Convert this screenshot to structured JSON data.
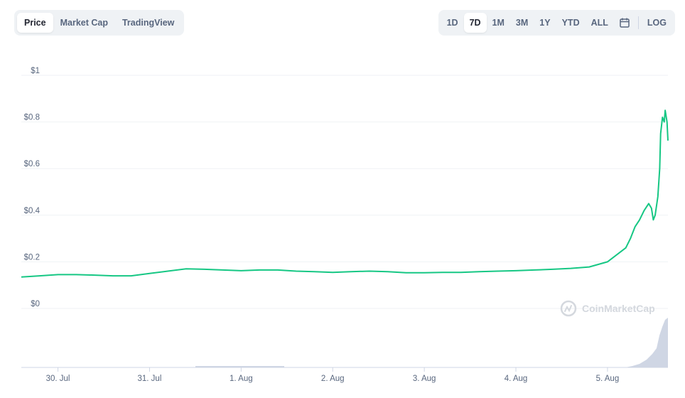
{
  "chart_tabs": [
    "Price",
    "Market Cap",
    "TradingView"
  ],
  "active_chart_tab": "Price",
  "ranges": [
    "1D",
    "7D",
    "1M",
    "3M",
    "1Y",
    "YTD",
    "ALL"
  ],
  "active_range": "7D",
  "log_label": "LOG",
  "icons": {
    "calendar": "calendar-icon",
    "watermark": "coinmarketcap-logo-icon"
  },
  "watermark": "CoinMarketCap",
  "colors": {
    "line": "#16c784",
    "volume": "#cfd6e4",
    "grid": "#eff2f5",
    "text": "#58667e"
  },
  "chart_data": {
    "type": "line",
    "y_tick_labels": [
      "$0",
      "$0.2",
      "$0.4",
      "$0.6",
      "$0.8",
      "$1"
    ],
    "ylim": [
      0,
      1
    ],
    "x_tick_labels": [
      "30. Jul",
      "31. Jul",
      "1. Aug",
      "2. Aug",
      "3. Aug",
      "4. Aug",
      "5. Aug"
    ],
    "x_tick_days": [
      0,
      1,
      2,
      3,
      4,
      5,
      6
    ],
    "xlim": [
      -0.4,
      6.66
    ],
    "grid": true,
    "legend": "none",
    "series": [
      {
        "x": [
          -0.4,
          -0.2,
          0.0,
          0.2,
          0.4,
          0.6,
          0.8,
          1.0,
          1.2,
          1.4,
          1.6,
          1.8,
          2.0,
          2.2,
          2.4,
          2.6,
          2.8,
          3.0,
          3.2,
          3.4,
          3.6,
          3.8,
          4.0,
          4.2,
          4.4,
          4.6,
          4.8,
          5.0,
          5.2,
          5.4,
          5.6,
          5.8,
          6.0,
          6.1,
          6.2,
          6.25,
          6.3,
          6.35,
          6.4,
          6.45,
          6.48,
          6.5,
          6.52,
          6.55,
          6.57,
          6.58,
          6.6,
          6.62,
          6.63,
          6.65,
          6.66
        ],
        "y": [
          0.135,
          0.14,
          0.145,
          0.145,
          0.143,
          0.14,
          0.14,
          0.15,
          0.16,
          0.17,
          0.168,
          0.165,
          0.162,
          0.165,
          0.165,
          0.16,
          0.158,
          0.155,
          0.158,
          0.16,
          0.158,
          0.153,
          0.153,
          0.155,
          0.155,
          0.158,
          0.16,
          0.162,
          0.165,
          0.168,
          0.172,
          0.178,
          0.2,
          0.23,
          0.26,
          0.3,
          0.35,
          0.38,
          0.42,
          0.45,
          0.43,
          0.38,
          0.4,
          0.48,
          0.6,
          0.75,
          0.82,
          0.8,
          0.85,
          0.8,
          0.72
        ]
      }
    ]
  }
}
